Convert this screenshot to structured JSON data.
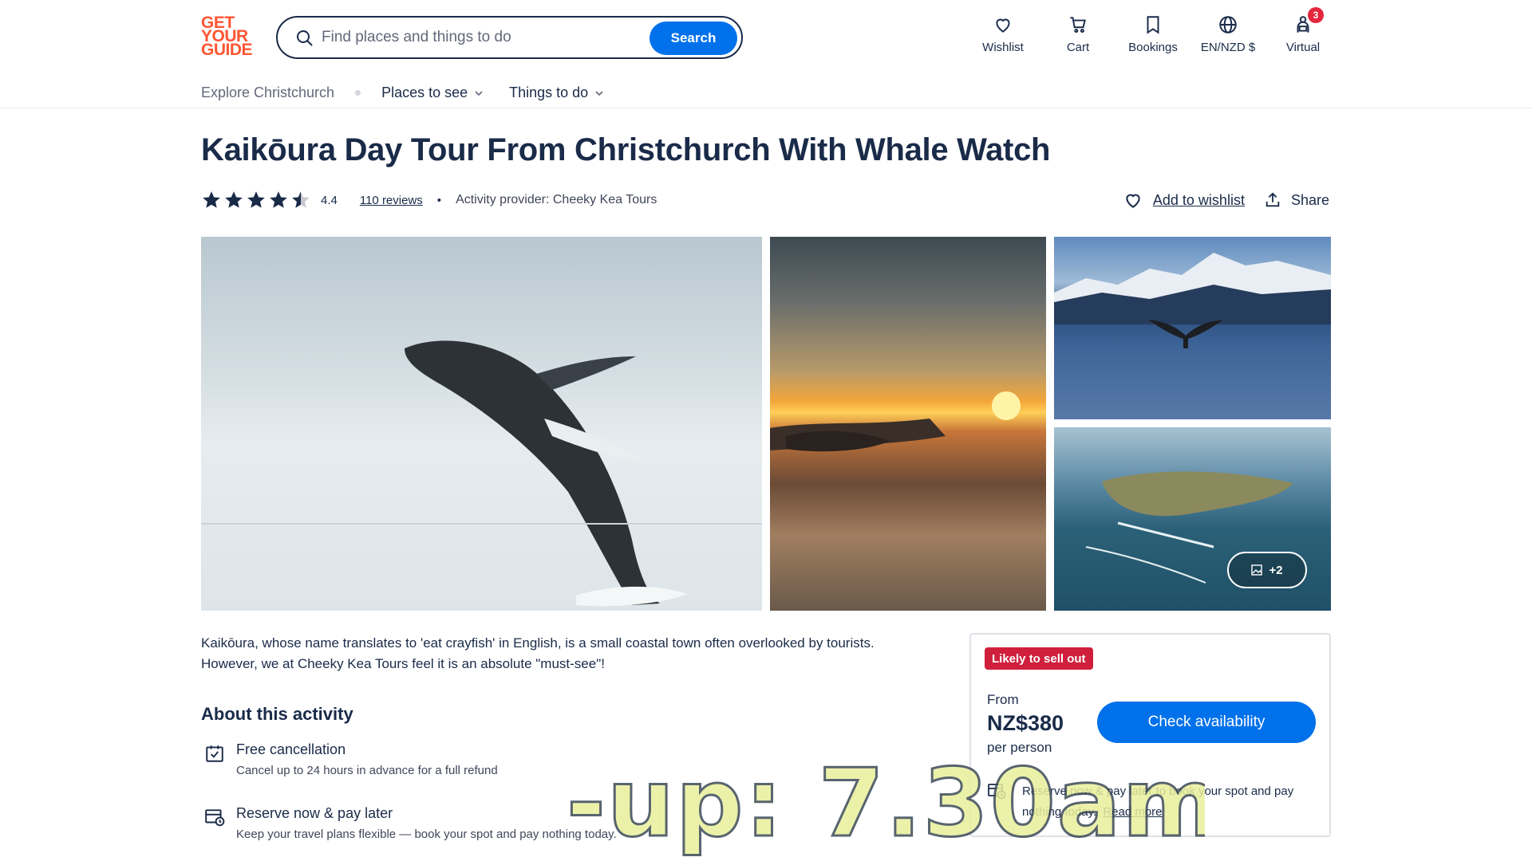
{
  "header": {
    "logo": [
      "GET",
      "YOUR",
      "GUIDE"
    ],
    "search": {
      "placeholder": "Find places and things to do",
      "button": "Search"
    },
    "nav": [
      {
        "label": "Wishlist",
        "icon": "heart-icon"
      },
      {
        "label": "Cart",
        "icon": "cart-icon"
      },
      {
        "label": "Bookings",
        "icon": "bookings-icon"
      },
      {
        "label": "EN/NZD $",
        "icon": "globe-icon"
      },
      {
        "label": "Virtual",
        "icon": "virtual-icon",
        "badge": "3"
      }
    ]
  },
  "subnav": {
    "explore": "Explore Christchurch",
    "places": "Places to see",
    "things": "Things to do"
  },
  "activity": {
    "title": "Kaikōura Day Tour From Christchurch With Whale Watch",
    "rating": "4.4",
    "stars": 4.4,
    "reviews": "110 reviews",
    "separator": "•",
    "provider": "Activity provider: Cheeky Kea Tours",
    "wishlist": "Add to wishlist",
    "share": "Share",
    "more_photos": "+2",
    "description_1": "Kaikōura, whose name translates to 'eat crayfish' in English, is a small coastal town often overlooked by tourists.",
    "description_2": "However, we at Cheeky Kea Tours feel it is an absolute \"must-see\"!"
  },
  "about": {
    "title": "About this activity",
    "features": [
      {
        "title": "Free cancellation",
        "subtitle": "Cancel up to 24 hours in advance for a full refund",
        "icon": "calendar-check-icon"
      },
      {
        "title": "Reserve now & pay later",
        "subtitle": "Keep your travel plans flexible — book your spot and pay nothing today.",
        "icon": "calendar-clock-icon"
      }
    ]
  },
  "booking": {
    "badge": "Likely to sell out",
    "from": "From",
    "price": "NZ$380",
    "per": "per person",
    "button": "Check availability",
    "note": "Reserve now & pay later to book your spot and pay nothing today.",
    "read_more": "Read more"
  },
  "overlay": {
    "text": "-up: 7.30am"
  },
  "colors": {
    "brand": "#ff5533",
    "primary": "#0071eb",
    "text": "#1a2b49",
    "alert": "#d01f3c"
  }
}
